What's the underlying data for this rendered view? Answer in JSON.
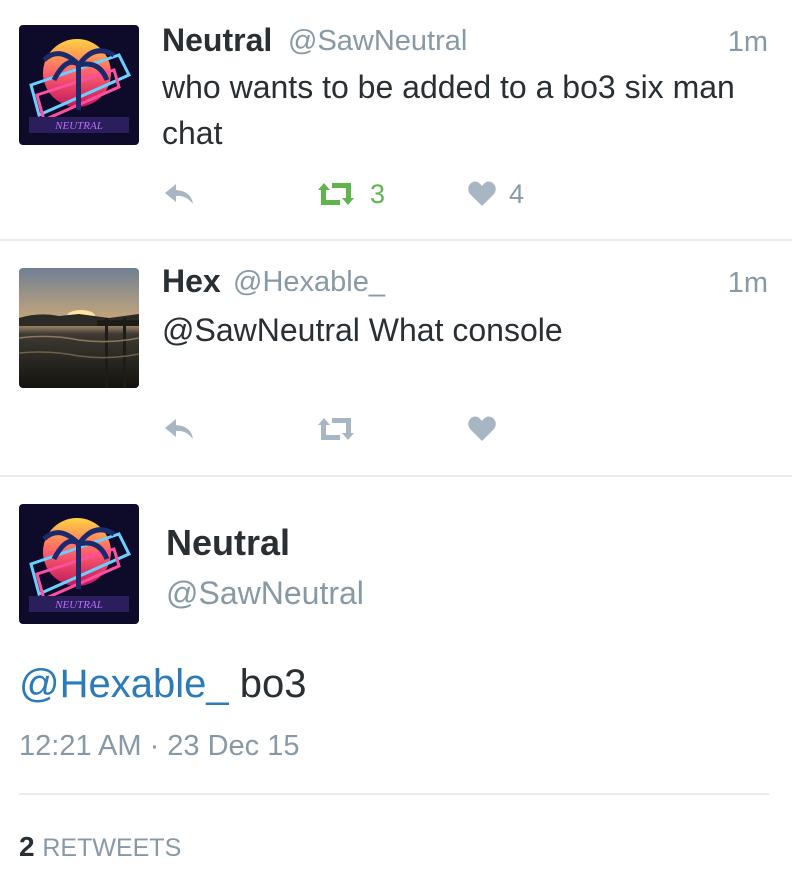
{
  "tweets": [
    {
      "name": "Neutral",
      "handle": "@SawNeutral",
      "time": "1m",
      "text": "who wants to be added to a bo3 six man chat",
      "retweets": "3",
      "likes": "4",
      "retweeted": true
    },
    {
      "name": "Hex",
      "handle": "@Hexable_",
      "time": "1m",
      "text": "@SawNeutral What console"
    }
  ],
  "detail": {
    "name": "Neutral",
    "handle": "@SawNeutral",
    "mention": "@Hexable_",
    "body": " bo3",
    "timestamp": "12:21 AM · 23 Dec 15",
    "retweet_count": "2",
    "retweet_label": "RETWEETS"
  },
  "colors": {
    "retweet_active": "#5fb54b",
    "icon_gray": "#a8b6c3",
    "link": "#2b7bb9",
    "handle": "#8899a6"
  },
  "icons": [
    "reply-icon",
    "retweet-icon",
    "like-icon"
  ]
}
